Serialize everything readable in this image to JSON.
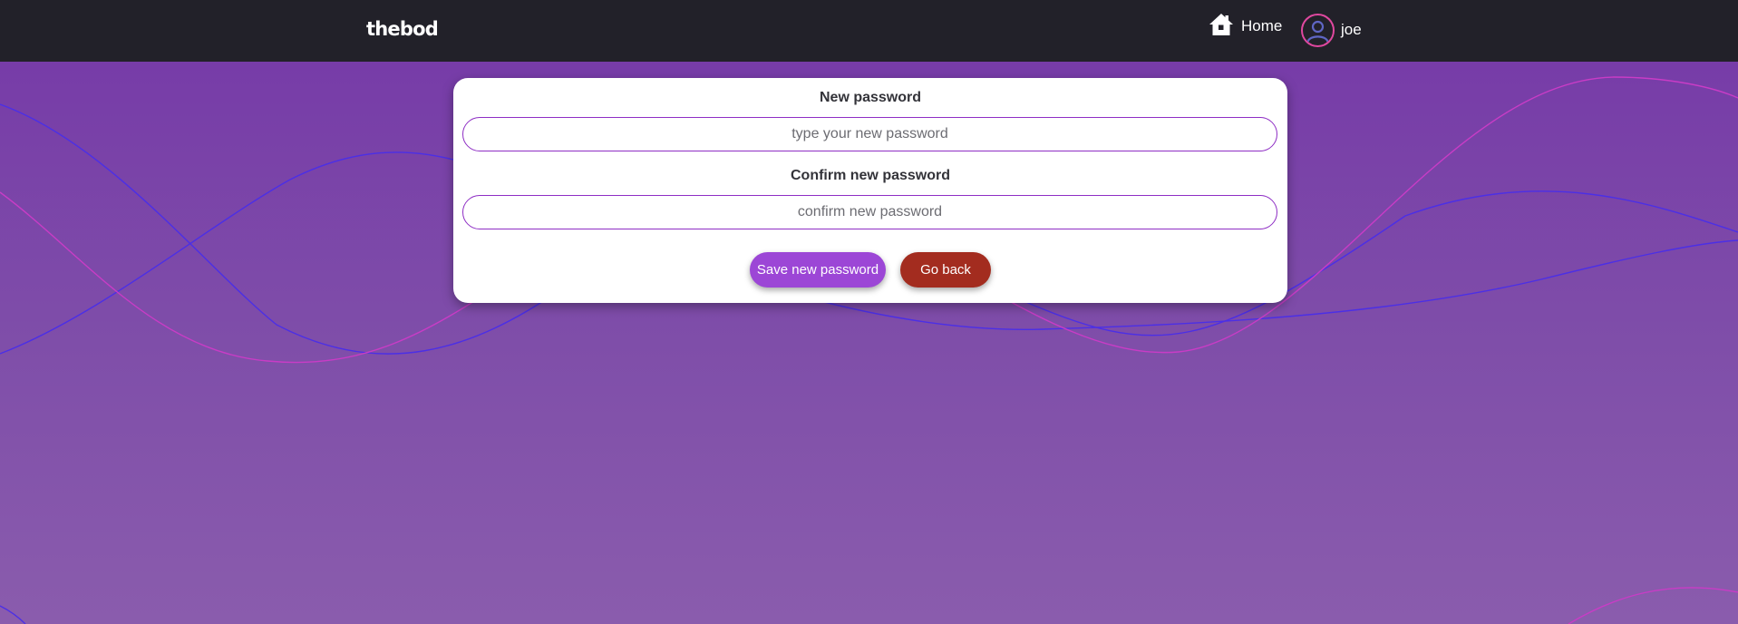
{
  "navbar": {
    "brand": "thebod",
    "home_label": "Home",
    "home_icon": "house-icon",
    "user_name": "joe",
    "user_icon": "user-avatar-icon"
  },
  "form": {
    "new_password_label": "New password",
    "new_password_placeholder": "type your new password",
    "new_password_value": "",
    "confirm_label": "Confirm new password",
    "confirm_placeholder": "confirm new password",
    "confirm_value": "",
    "save_button": "Save new password",
    "back_button": "Go back"
  },
  "colors": {
    "navbar_bg": "#222129",
    "background_top": "#7538a8",
    "background_bottom": "#8a5cad",
    "accent_purple": "#9c46d6",
    "back_red": "#a32c1f",
    "avatar_ring": "#e0489f",
    "wave_blue": "#4b2fe6",
    "wave_magenta": "#c93cc6"
  }
}
